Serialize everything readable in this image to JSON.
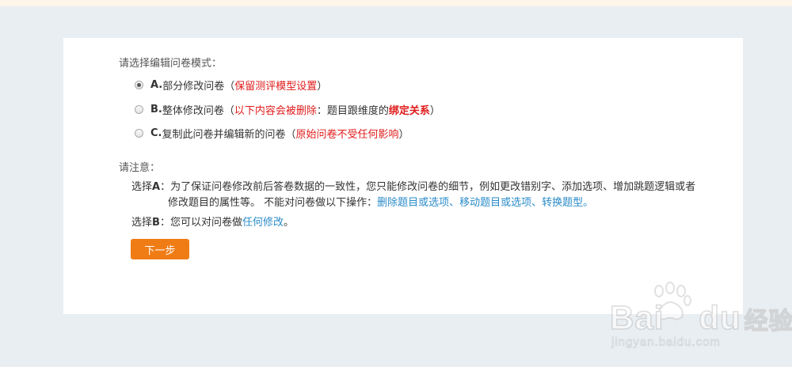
{
  "header": {
    "prompt": "请选择编辑问卷模式："
  },
  "options": [
    {
      "key": "A.",
      "text": "部分修改问卷（",
      "highlight": "保留测评模型设置",
      "close": "）",
      "checked": true
    },
    {
      "key": "B.",
      "text": "整体修改问卷（",
      "highlight": "以下内容会被删除",
      "middle": "：题目跟维度的",
      "highlight2": "绑定关系",
      "close": "）",
      "checked": false
    },
    {
      "key": "C.",
      "text": "复制此问卷并编辑新的问卷（",
      "highlight": "原始问卷不受任何影响",
      "close": "）",
      "checked": false
    }
  ],
  "notes": {
    "title": "请注意：",
    "a_label_pre": "选择",
    "a_label_key": "A",
    "a_label_post": "：",
    "a_line1": "为了保证问卷修改前后答卷数据的一致性，您只能修改问卷的细节，例如更改错别字、添加选项、增加跳题逻辑或者",
    "a_line2": "修改题目的属性等。 不能对问卷做以下操作：",
    "a_link": "删除题目或选项、移动题目或选项、转换题型。",
    "b_label_pre": "选择",
    "b_label_key": "B",
    "b_label_post": "：",
    "b_text": "您可以对问卷做",
    "b_link": "任何修改",
    "b_end": "。"
  },
  "buttons": {
    "next": "下一步"
  },
  "watermark": {
    "brand": "Bai",
    "brand2": "du",
    "suffix": "经验",
    "url": "jingyan.baidu.com"
  },
  "colors": {
    "accent": "#f07c16",
    "warning": "#e01b1b",
    "link": "#2a8bc9"
  }
}
